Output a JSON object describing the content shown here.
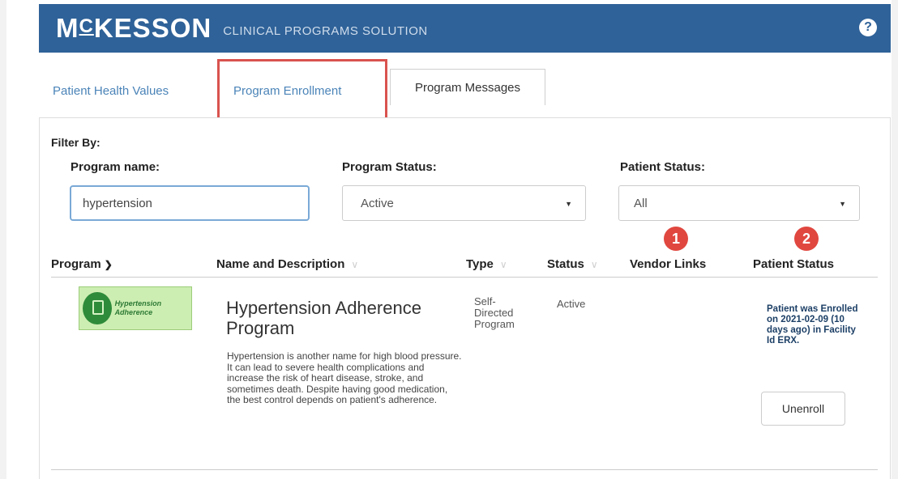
{
  "header": {
    "logo_text": "MCKESSON",
    "logo_prefix": "M",
    "logo_c": "C",
    "logo_rest": "KESSON",
    "app_title": "CLINICAL PROGRAMS SOLUTION",
    "help_symbol": "?"
  },
  "tabs": [
    {
      "label": "Patient Health Values"
    },
    {
      "label": "Program Enrollment",
      "selected": true,
      "highlight_color": "#d9534f"
    },
    {
      "label": "Program Messages"
    }
  ],
  "filters": {
    "heading": "Filter By:",
    "program_name": {
      "label": "Program name:",
      "value": "hypertension"
    },
    "program_status": {
      "label": "Program Status:",
      "value": "Active"
    },
    "patient_status": {
      "label": "Patient Status:",
      "value": "All"
    }
  },
  "badges": [
    "1",
    "2"
  ],
  "table": {
    "columns": [
      "Program",
      "Name and Description",
      "Type",
      "Status",
      "Vendor Links",
      "Patient Status"
    ],
    "rows": [
      {
        "program_image_text": "Hypertension Adherence",
        "name": "Hypertension Adherence Program",
        "description": "Hypertension is another name for high blood pressure. It can lead to severe health complications and increase the risk of heart disease, stroke, and sometimes death. Despite having good medication, the best control depends on patient's adherence.",
        "type": "Self-Directed Program",
        "status": "Active",
        "vendor_links": "",
        "patient_status": "Patient was Enrolled on 2021-02-09 (10 days ago) in Facility Id ERX.",
        "action_label": "Unenroll"
      }
    ]
  },
  "colors": {
    "header_bg": "#2f6298",
    "tab_link": "#4b84b8",
    "badge": "#e0473f",
    "input_border": "#7aa9d6"
  },
  "icons": {
    "help": "help-icon",
    "sort_program": "chevron-down-icon",
    "sort_other": "sort-chevron-icon",
    "select_caret": "caret-down-icon"
  }
}
